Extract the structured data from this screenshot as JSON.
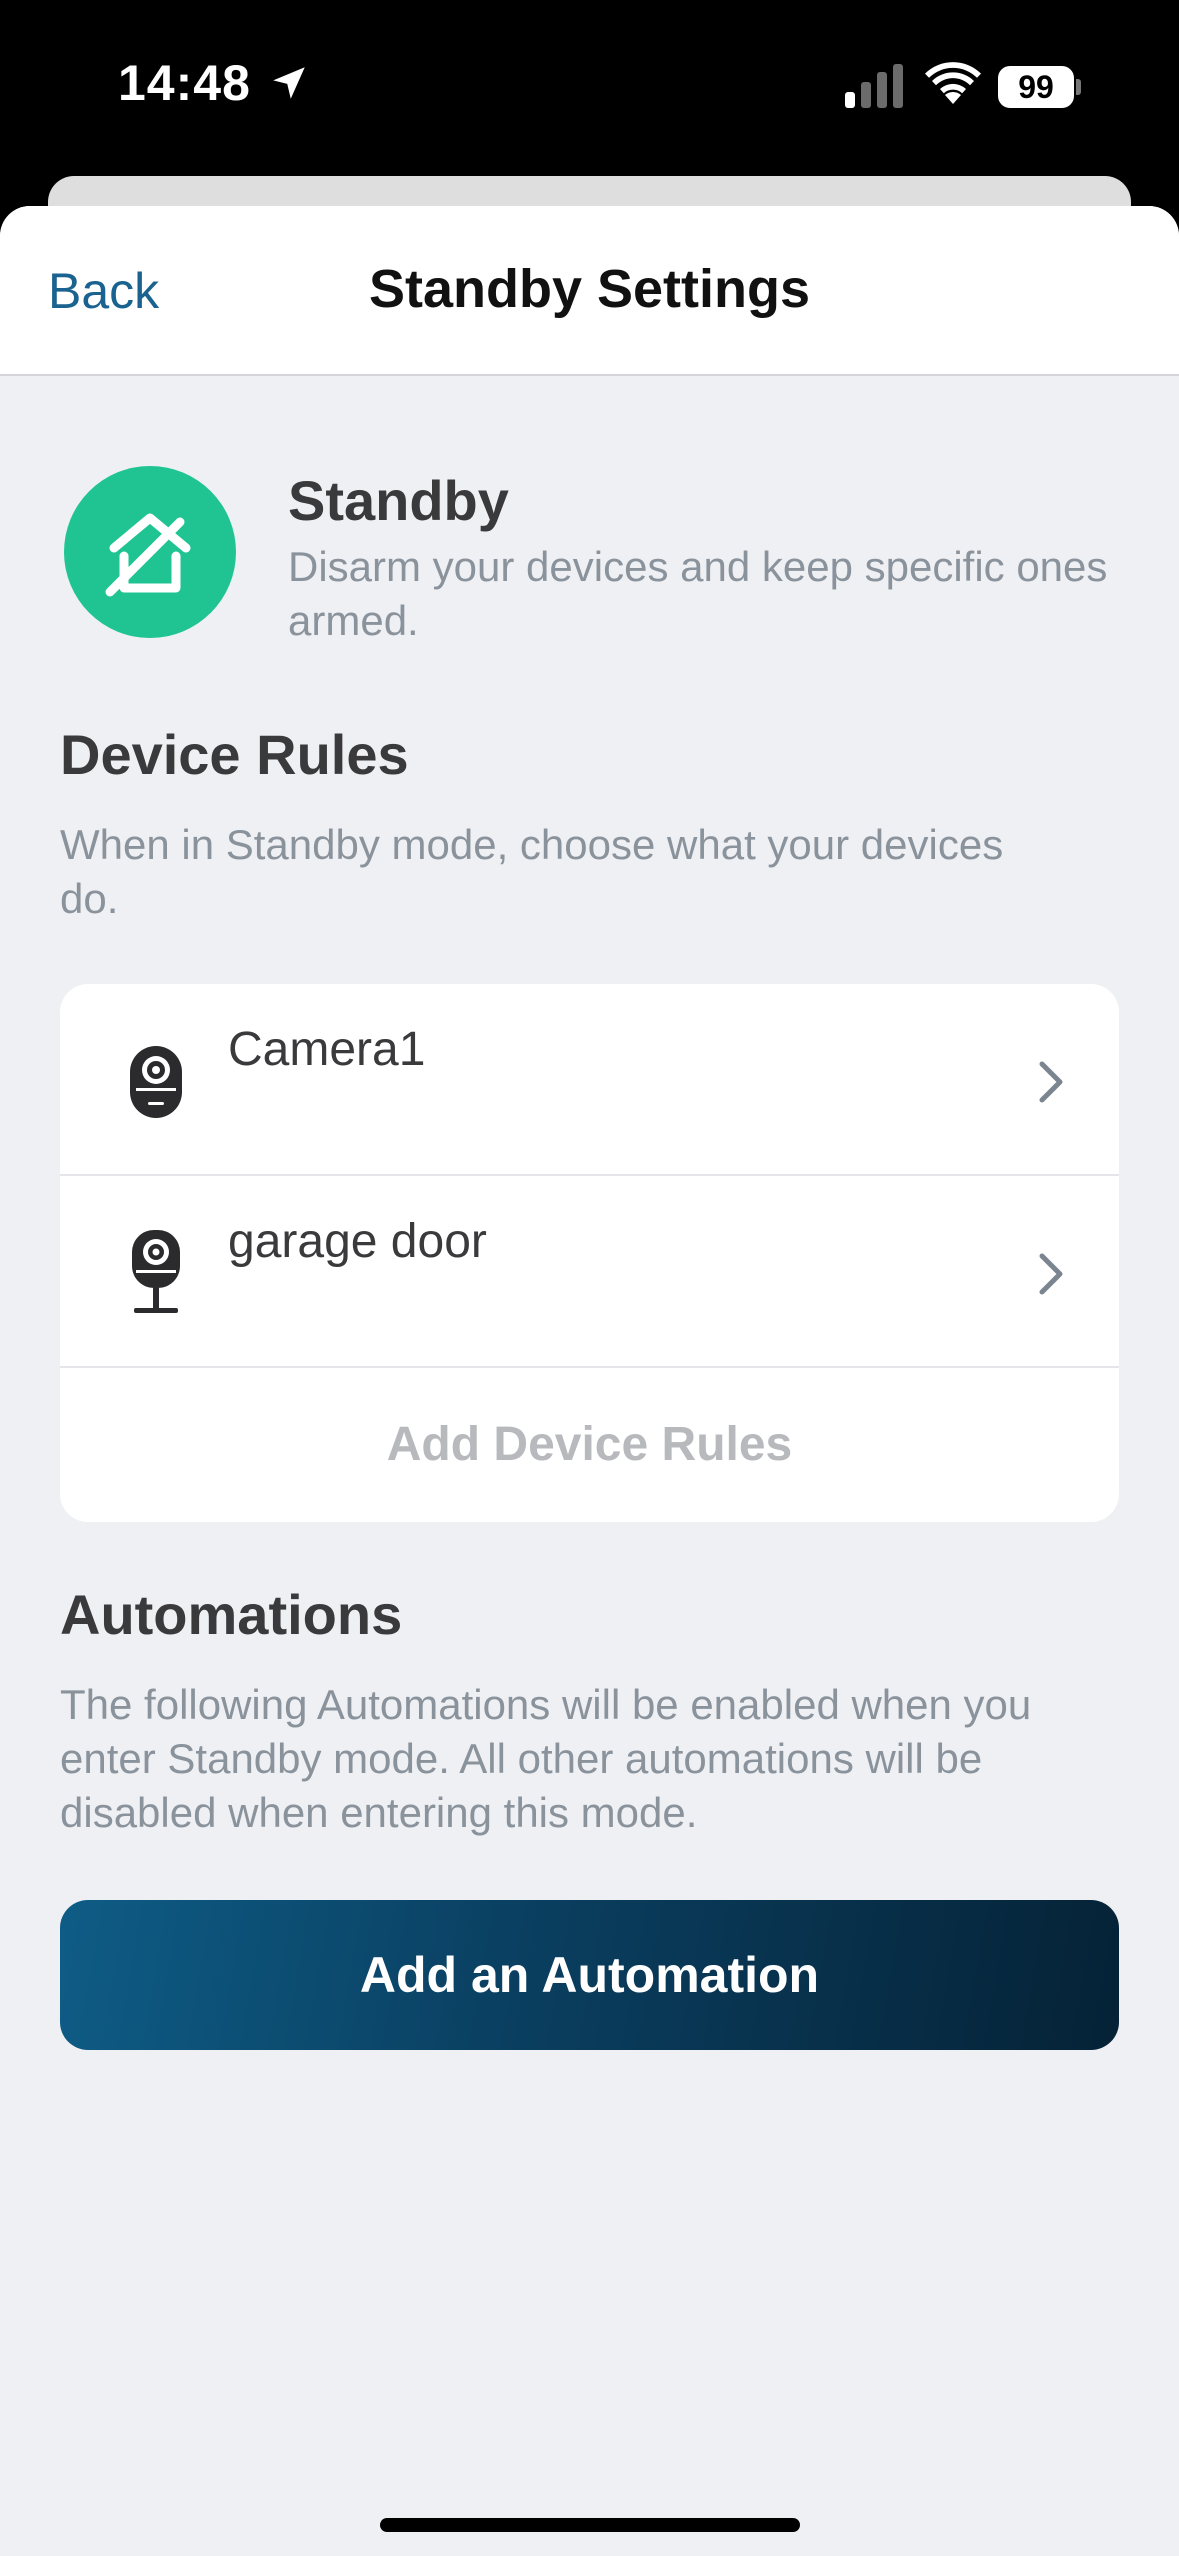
{
  "status_bar": {
    "time": "14:48",
    "battery": "99"
  },
  "nav": {
    "back_label": "Back",
    "title": "Standby Settings"
  },
  "mode": {
    "icon": "house-slash-icon",
    "title": "Standby",
    "description": "Disarm your devices and keep specific ones armed."
  },
  "device_rules": {
    "title": "Device Rules",
    "description": "When in Standby mode, choose what your devices do.",
    "devices": [
      {
        "name": "Camera1",
        "icon": "camera-icon"
      },
      {
        "name": "garage door",
        "icon": "camera-stand-icon"
      }
    ],
    "add_label": "Add Device Rules"
  },
  "automations": {
    "title": "Automations",
    "description": "The following Automations will be enabled when you enter Standby mode. All other automations will be disabled when entering this mode.",
    "add_button_label": "Add an Automation"
  },
  "colors": {
    "accent": "#1a6390",
    "mode_green": "#1fc492",
    "button_gradient_start": "#0e5c86",
    "button_gradient_end": "#052236"
  }
}
